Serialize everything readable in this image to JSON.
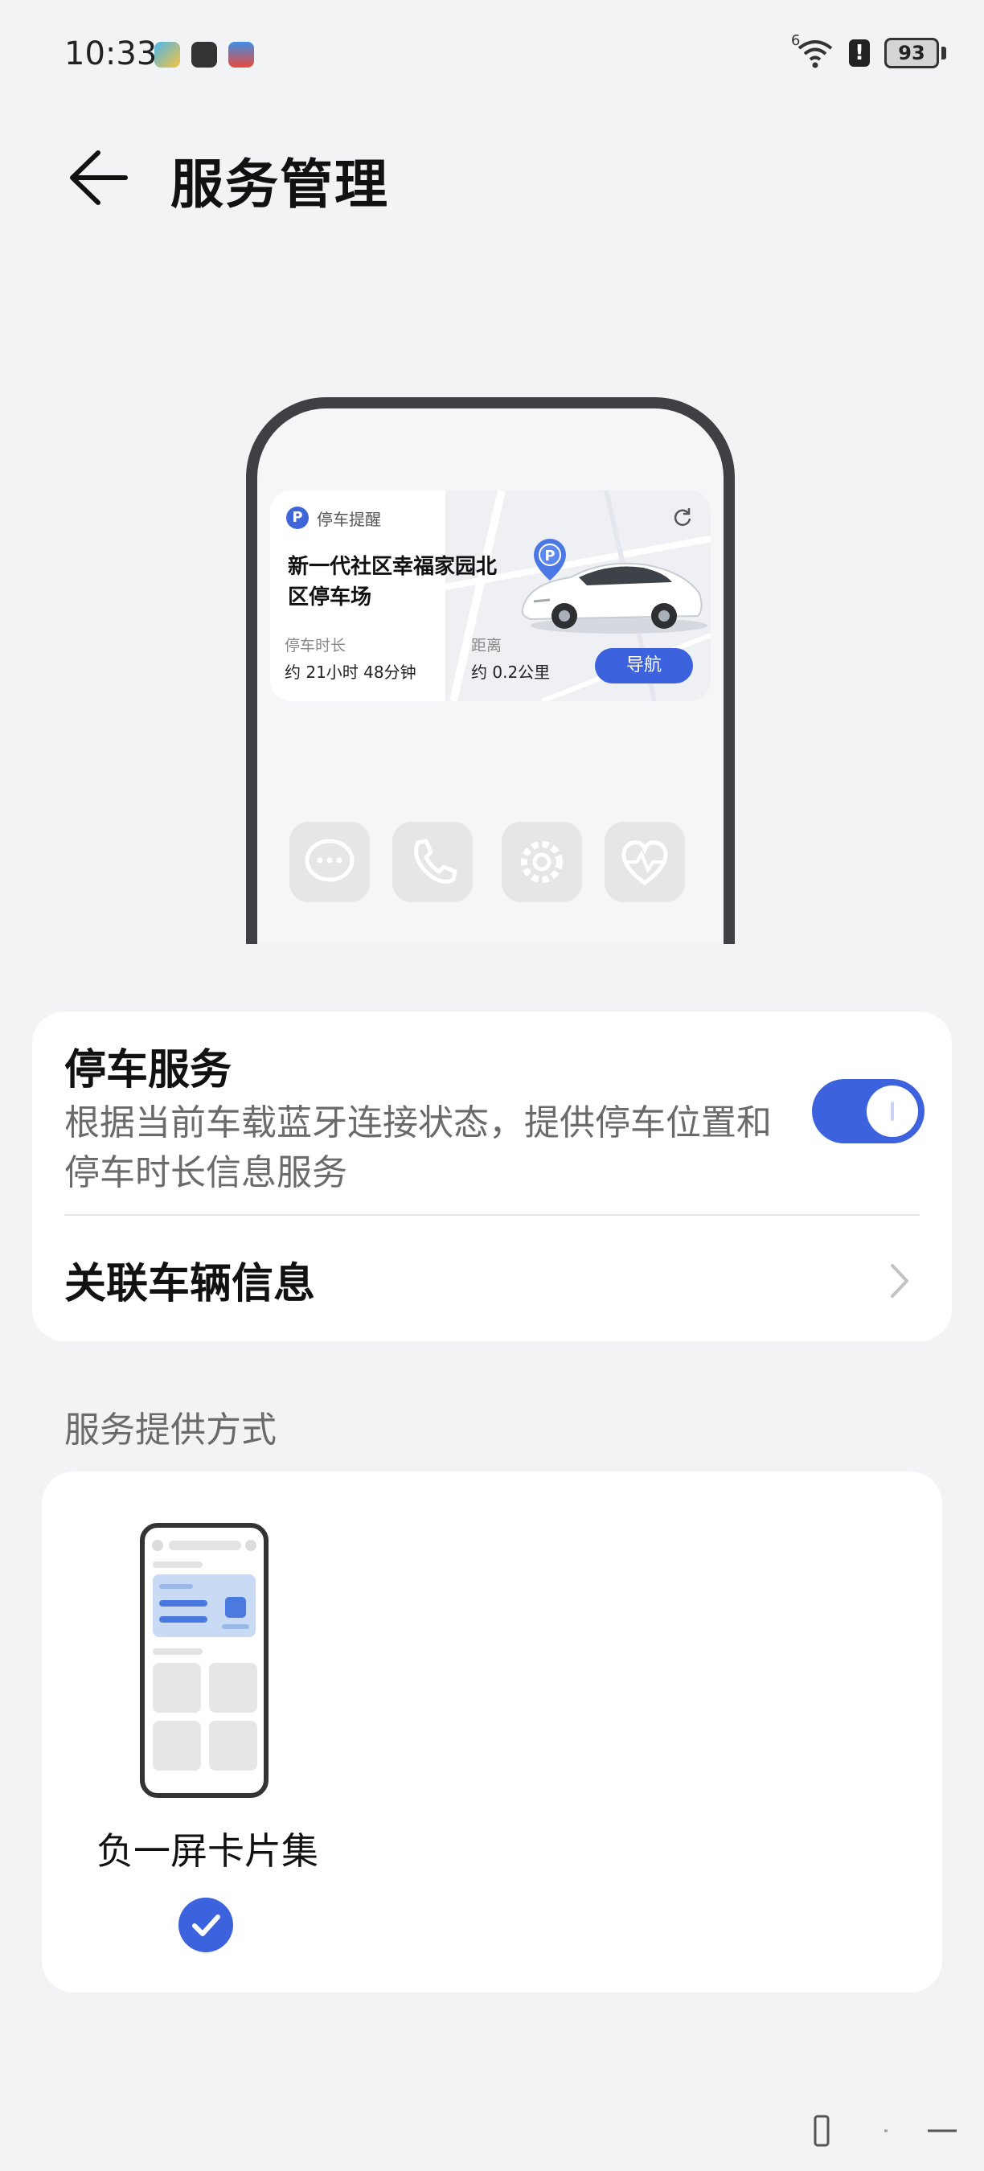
{
  "status_bar": {
    "time": "10:33",
    "battery": "93",
    "alert_glyph": "!",
    "network_superscript": "6",
    "icons": [
      "wifi-icon",
      "alert-icon",
      "battery-icon"
    ]
  },
  "header": {
    "back_icon": "arrow-left-icon",
    "title": "服务管理"
  },
  "preview": {
    "card": {
      "app_badge": "P",
      "app_name": "停车提醒",
      "pin_label": "P",
      "location": "新一代社区幸福家园北区停车场",
      "duration_label": "停车时长",
      "duration_value": "约 21小时 48分钟",
      "distance_label": "距离",
      "distance_value": "约 0.2公里",
      "nav_button": "导航"
    },
    "app_icons": [
      "message-icon",
      "phone-icon",
      "settings-icon",
      "health-icon"
    ]
  },
  "parking_service": {
    "title": "停车服务",
    "description": "根据当前车载蓝牙连接状态，提供停车位置和停车时长信息服务",
    "enabled": true,
    "linked_vehicle_label": "关联车辆信息"
  },
  "service_method": {
    "section_title": "服务提供方式",
    "option_label": "负一屏卡片集",
    "selected": true
  },
  "colors": {
    "background": "#f1f3f5",
    "accent": "#3c63dd",
    "card": "#ffffff",
    "secondary_text": "#6a6a6a"
  }
}
